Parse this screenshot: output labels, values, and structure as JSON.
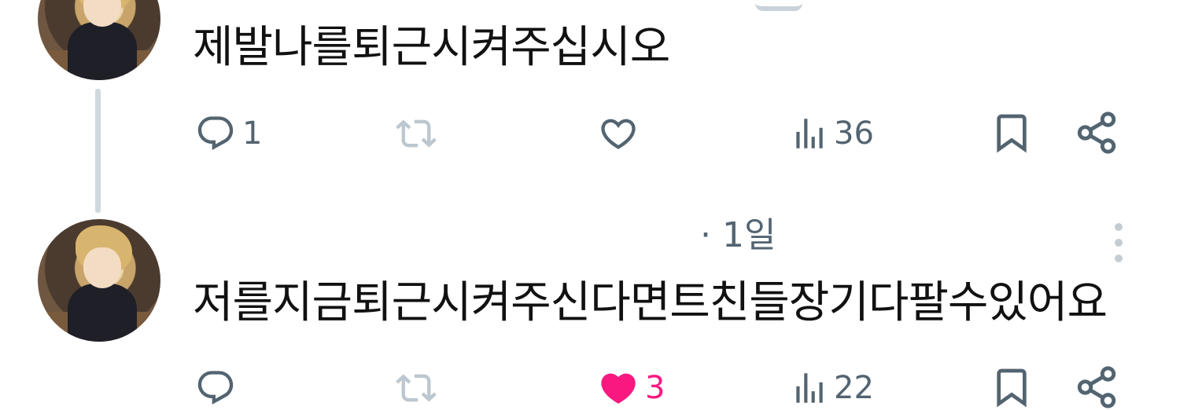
{
  "tweets": [
    {
      "text": "제발나를퇴근시켜주십시오",
      "stats": {
        "replies": "1",
        "retweets": "",
        "likes": "",
        "views": "36"
      }
    },
    {
      "time": "· 1일",
      "text": "저를지금퇴근시켜주신다면트친들장기다팔수있어요",
      "stats": {
        "replies": "",
        "retweets": "",
        "likes": "3",
        "views": "22"
      }
    }
  ],
  "icons": {
    "reply": "reply-icon",
    "retweet": "retweet-icon",
    "like": "heart-icon",
    "views": "views-icon",
    "bookmark": "bookmark-icon",
    "share": "share-icon",
    "more": "more-icon"
  },
  "colors": {
    "text": "#0f1419",
    "muted": "#536471",
    "like_active": "#f91880",
    "thread_line": "#cfd9de"
  }
}
